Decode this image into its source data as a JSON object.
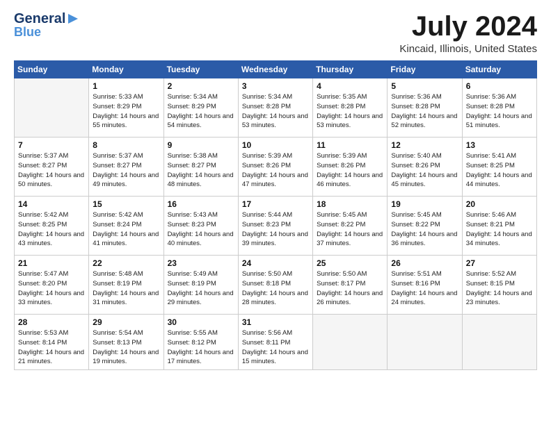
{
  "header": {
    "logo_top": "General",
    "logo_bottom": "Blue",
    "month_title": "July 2024",
    "location": "Kincaid, Illinois, United States"
  },
  "days_of_week": [
    "Sunday",
    "Monday",
    "Tuesday",
    "Wednesday",
    "Thursday",
    "Friday",
    "Saturday"
  ],
  "weeks": [
    [
      {
        "day": "",
        "empty": true
      },
      {
        "day": "1",
        "sunrise": "5:33 AM",
        "sunset": "8:29 PM",
        "daylight": "14 hours and 55 minutes."
      },
      {
        "day": "2",
        "sunrise": "5:34 AM",
        "sunset": "8:29 PM",
        "daylight": "14 hours and 54 minutes."
      },
      {
        "day": "3",
        "sunrise": "5:34 AM",
        "sunset": "8:28 PM",
        "daylight": "14 hours and 53 minutes."
      },
      {
        "day": "4",
        "sunrise": "5:35 AM",
        "sunset": "8:28 PM",
        "daylight": "14 hours and 53 minutes."
      },
      {
        "day": "5",
        "sunrise": "5:36 AM",
        "sunset": "8:28 PM",
        "daylight": "14 hours and 52 minutes."
      },
      {
        "day": "6",
        "sunrise": "5:36 AM",
        "sunset": "8:28 PM",
        "daylight": "14 hours and 51 minutes."
      }
    ],
    [
      {
        "day": "7",
        "sunrise": "5:37 AM",
        "sunset": "8:27 PM",
        "daylight": "14 hours and 50 minutes."
      },
      {
        "day": "8",
        "sunrise": "5:37 AM",
        "sunset": "8:27 PM",
        "daylight": "14 hours and 49 minutes."
      },
      {
        "day": "9",
        "sunrise": "5:38 AM",
        "sunset": "8:27 PM",
        "daylight": "14 hours and 48 minutes."
      },
      {
        "day": "10",
        "sunrise": "5:39 AM",
        "sunset": "8:26 PM",
        "daylight": "14 hours and 47 minutes."
      },
      {
        "day": "11",
        "sunrise": "5:39 AM",
        "sunset": "8:26 PM",
        "daylight": "14 hours and 46 minutes."
      },
      {
        "day": "12",
        "sunrise": "5:40 AM",
        "sunset": "8:26 PM",
        "daylight": "14 hours and 45 minutes."
      },
      {
        "day": "13",
        "sunrise": "5:41 AM",
        "sunset": "8:25 PM",
        "daylight": "14 hours and 44 minutes."
      }
    ],
    [
      {
        "day": "14",
        "sunrise": "5:42 AM",
        "sunset": "8:25 PM",
        "daylight": "14 hours and 43 minutes."
      },
      {
        "day": "15",
        "sunrise": "5:42 AM",
        "sunset": "8:24 PM",
        "daylight": "14 hours and 41 minutes."
      },
      {
        "day": "16",
        "sunrise": "5:43 AM",
        "sunset": "8:23 PM",
        "daylight": "14 hours and 40 minutes."
      },
      {
        "day": "17",
        "sunrise": "5:44 AM",
        "sunset": "8:23 PM",
        "daylight": "14 hours and 39 minutes."
      },
      {
        "day": "18",
        "sunrise": "5:45 AM",
        "sunset": "8:22 PM",
        "daylight": "14 hours and 37 minutes."
      },
      {
        "day": "19",
        "sunrise": "5:45 AM",
        "sunset": "8:22 PM",
        "daylight": "14 hours and 36 minutes."
      },
      {
        "day": "20",
        "sunrise": "5:46 AM",
        "sunset": "8:21 PM",
        "daylight": "14 hours and 34 minutes."
      }
    ],
    [
      {
        "day": "21",
        "sunrise": "5:47 AM",
        "sunset": "8:20 PM",
        "daylight": "14 hours and 33 minutes."
      },
      {
        "day": "22",
        "sunrise": "5:48 AM",
        "sunset": "8:19 PM",
        "daylight": "14 hours and 31 minutes."
      },
      {
        "day": "23",
        "sunrise": "5:49 AM",
        "sunset": "8:19 PM",
        "daylight": "14 hours and 29 minutes."
      },
      {
        "day": "24",
        "sunrise": "5:50 AM",
        "sunset": "8:18 PM",
        "daylight": "14 hours and 28 minutes."
      },
      {
        "day": "25",
        "sunrise": "5:50 AM",
        "sunset": "8:17 PM",
        "daylight": "14 hours and 26 minutes."
      },
      {
        "day": "26",
        "sunrise": "5:51 AM",
        "sunset": "8:16 PM",
        "daylight": "14 hours and 24 minutes."
      },
      {
        "day": "27",
        "sunrise": "5:52 AM",
        "sunset": "8:15 PM",
        "daylight": "14 hours and 23 minutes."
      }
    ],
    [
      {
        "day": "28",
        "sunrise": "5:53 AM",
        "sunset": "8:14 PM",
        "daylight": "14 hours and 21 minutes."
      },
      {
        "day": "29",
        "sunrise": "5:54 AM",
        "sunset": "8:13 PM",
        "daylight": "14 hours and 19 minutes."
      },
      {
        "day": "30",
        "sunrise": "5:55 AM",
        "sunset": "8:12 PM",
        "daylight": "14 hours and 17 minutes."
      },
      {
        "day": "31",
        "sunrise": "5:56 AM",
        "sunset": "8:11 PM",
        "daylight": "14 hours and 15 minutes."
      },
      {
        "day": "",
        "empty": true
      },
      {
        "day": "",
        "empty": true
      },
      {
        "day": "",
        "empty": true
      }
    ]
  ]
}
